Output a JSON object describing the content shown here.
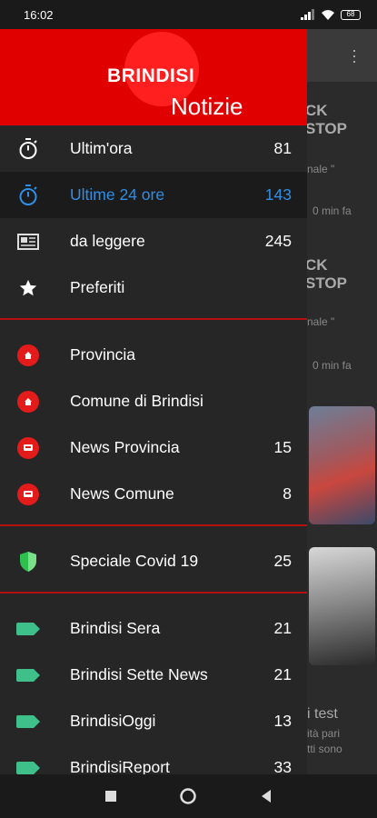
{
  "status_bar": {
    "time": "16:02",
    "battery": "68"
  },
  "header": {
    "brand": "BRINDISI",
    "subtitle": "Notizie"
  },
  "menu": {
    "main": [
      {
        "label": "Ultim'ora",
        "count": "81",
        "icon": "stopwatch-icon"
      },
      {
        "label": "Ultime 24 ore",
        "count": "143",
        "icon": "stopwatch-icon",
        "active": true
      },
      {
        "label": "da leggere",
        "count": "245",
        "icon": "newspaper-icon"
      },
      {
        "label": "Preferiti",
        "count": "",
        "icon": "star-icon"
      }
    ],
    "local": [
      {
        "label": "Provincia",
        "count": "",
        "icon": "home-badge-icon"
      },
      {
        "label": "Comune di Brindisi",
        "count": "",
        "icon": "home-badge-icon"
      },
      {
        "label": "News Provincia",
        "count": "15",
        "icon": "bus-badge-icon"
      },
      {
        "label": "News Comune",
        "count": "8",
        "icon": "bus-badge-icon"
      }
    ],
    "special": [
      {
        "label": "Speciale Covid 19",
        "count": "25",
        "icon": "shield-icon"
      }
    ],
    "sources": [
      {
        "label": "Brindisi Sera",
        "count": "21",
        "icon": "tag-icon"
      },
      {
        "label": "Brindisi Sette News",
        "count": "21",
        "icon": "tag-icon"
      },
      {
        "label": "BrindisiOggi",
        "count": "13",
        "icon": "tag-icon"
      },
      {
        "label": "BrindisiReport",
        "count": "33",
        "icon": "tag-icon"
      }
    ]
  },
  "background": {
    "a1": "CK",
    "a2": "STOP",
    "a3": "nale \"",
    "a4": "0 min fa",
    "b1": "CK",
    "b2": "STOP",
    "b3": "nale \"",
    "b4": "0 min fa",
    "c1": "i test",
    "c2": "ità pari",
    "c3": "tti sono"
  },
  "colors": {
    "header": "#e00000",
    "active": "#2f8fe6",
    "divider": "#b81010",
    "tag": "#3fbf8a",
    "badge": "#e31b1b"
  }
}
